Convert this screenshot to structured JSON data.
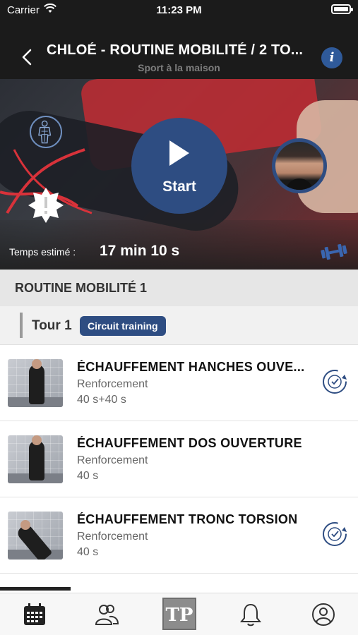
{
  "status_bar": {
    "carrier": "Carrier",
    "time": "11:23 PM"
  },
  "nav": {
    "title": "CHLOÉ - ROUTINE MOBILITÉ / 2 TO...",
    "subtitle": "Sport à la maison",
    "back_icon": "chevron-left-icon",
    "info_icon": "info-icon"
  },
  "hero": {
    "start_label": "Start",
    "estimated_label": "Temps estimé :",
    "estimated_value": "17 min 10 s",
    "icons": [
      "body-anatomy-icon",
      "warning-badge-icon",
      "play-icon",
      "coach-avatar",
      "dumbbell-icon"
    ]
  },
  "section": {
    "title": "ROUTINE MOBILITÉ 1"
  },
  "tour": {
    "label": "Tour 1",
    "badge": "Circuit training"
  },
  "exercises": [
    {
      "title": "ÉCHAUFFEMENT HANCHES OUVE...",
      "type": "Renforcement",
      "duration": "40 s+40 s",
      "has_status_icon": true
    },
    {
      "title": "ÉCHAUFFEMENT DOS OUVERTURE",
      "type": "Renforcement",
      "duration": "40 s",
      "has_status_icon": false
    },
    {
      "title": "ÉCHAUFFEMENT TRONC TORSION",
      "type": "Renforcement",
      "duration": "40 s",
      "has_status_icon": true
    }
  ],
  "tabbar": {
    "items": [
      "calendar-icon",
      "community-icon",
      "tp-logo",
      "bell-icon",
      "profile-icon"
    ],
    "logo_text": "TP"
  },
  "colors": {
    "accent": "#2e4d82",
    "dark": "#1b1b1b",
    "section_bg": "#e6e6e6"
  }
}
